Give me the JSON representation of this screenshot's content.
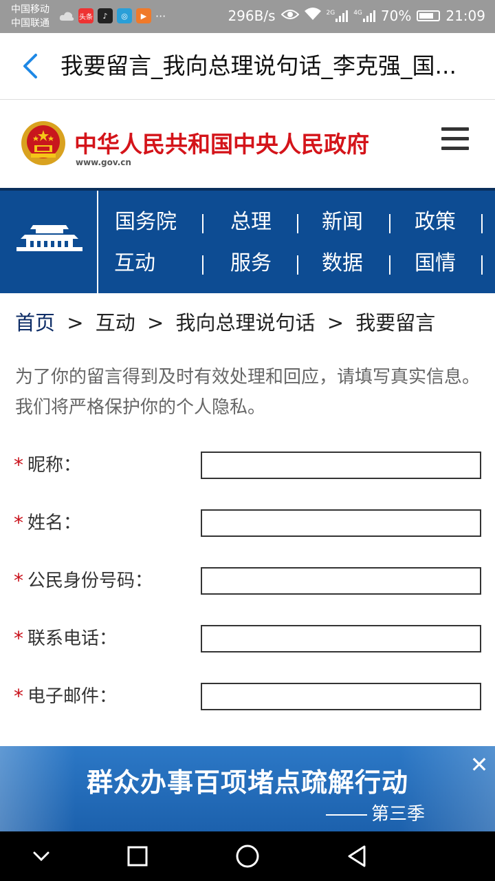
{
  "status_bar": {
    "carrier1": "中国移动",
    "carrier2": "中国联通",
    "net_speed": "296B/s",
    "net_2g": "2G",
    "net_4g": "4G",
    "battery": "70%",
    "time": "21:09",
    "notif_more": "···",
    "notif_toutiao": "头条"
  },
  "browser": {
    "title": "我要留言_我向总理说句话_李克强_国..."
  },
  "site": {
    "name": "中华人民共和国中央人民政府",
    "url": "www.gov.cn"
  },
  "nav": {
    "items": [
      "国务院",
      "总理",
      "新闻",
      "政策",
      "互动",
      "服务",
      "数据",
      "国情"
    ]
  },
  "breadcrumb": {
    "home": "首页",
    "sep": ">",
    "level1": "互动",
    "level2": "我向总理说句话",
    "current": "我要留言"
  },
  "intro": "为了你的留言得到及时有效处理和回应，请填写真实信息。我们将严格保护你的个人隐私。",
  "form": {
    "required_mark": "*",
    "fields": [
      {
        "label": "昵称：",
        "value": ""
      },
      {
        "label": "姓名：",
        "value": ""
      },
      {
        "label": "公民身份号码：",
        "value": ""
      },
      {
        "label": "联系电话：",
        "value": ""
      },
      {
        "label": "电子邮件：",
        "value": ""
      }
    ]
  },
  "banner": {
    "title": "群众办事百项堵点疏解行动",
    "subtitle": "第三季",
    "close": "✕"
  },
  "colors": {
    "brand_red": "#d4141a",
    "nav_blue": "#0d4c93",
    "banner_blue": "#2c78c6",
    "required_red": "#c9101a"
  }
}
